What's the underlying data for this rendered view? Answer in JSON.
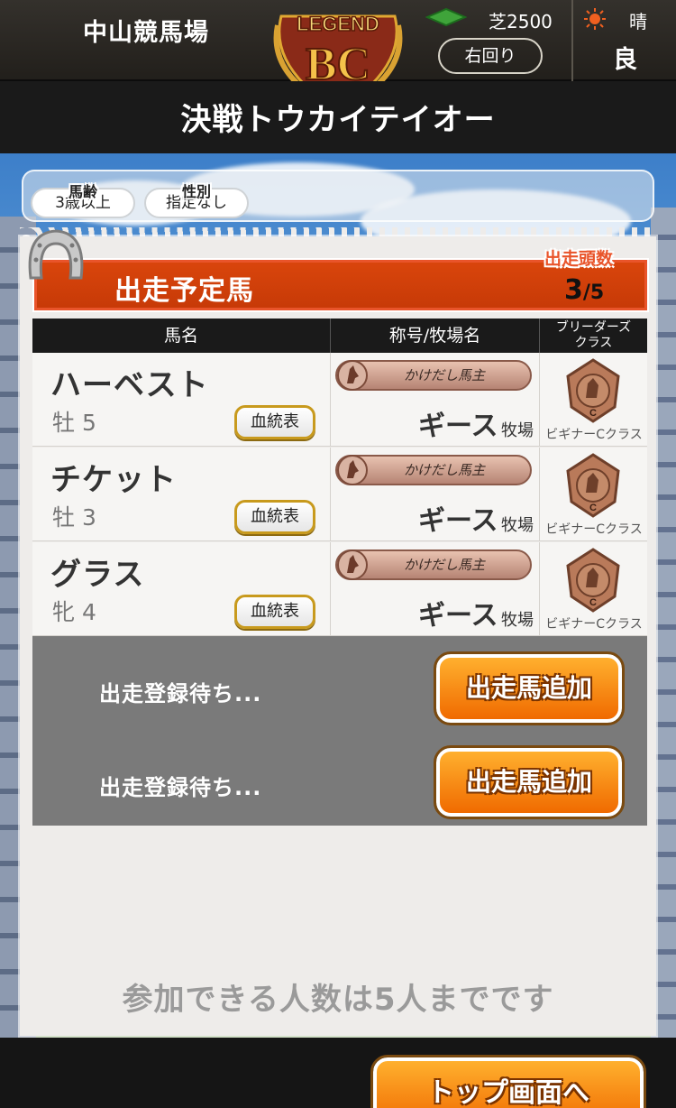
{
  "header": {
    "venue": "中山競馬場",
    "logo_text_top": "LEGEND",
    "logo_text_main": "BC",
    "surface": "芝2500",
    "direction": "右回り",
    "weather": "晴",
    "condition": "良"
  },
  "title": "決戦トウカイテイオー",
  "filters": {
    "age": {
      "label": "馬齢",
      "value": "3歳以上"
    },
    "sex": {
      "label": "性別",
      "value": "指定なし"
    }
  },
  "entries_panel": {
    "title": "出走予定馬",
    "count_label": "出走頭数",
    "count": "3",
    "count_max": "/5"
  },
  "table": {
    "headers": {
      "name": "馬名",
      "owner": "称号/牧場名",
      "class_line1": "ブリーダーズ",
      "class_line2": "クラス"
    },
    "rows": [
      {
        "name": "ハーベスト",
        "sex_age": "牡 5",
        "pedigree": "血統表",
        "title": "かけだし馬主",
        "farm": "ギース",
        "farm_suffix": "牧場",
        "class": "ビギナーCクラス"
      },
      {
        "name": "チケット",
        "sex_age": "牡 3",
        "pedigree": "血統表",
        "title": "かけだし馬主",
        "farm": "ギース",
        "farm_suffix": "牧場",
        "class": "ビギナーCクラス"
      },
      {
        "name": "グラス",
        "sex_age": "牝 4",
        "pedigree": "血統表",
        "title": "かけだし馬主",
        "farm": "ギース",
        "farm_suffix": "牧場",
        "class": "ビギナーCクラス"
      }
    ]
  },
  "pending": [
    {
      "text": "出走登録待ち...",
      "button": "出走馬追加"
    },
    {
      "text": "出走登録待ち...",
      "button": "出走馬追加"
    }
  ],
  "note": "参加できる人数は5人までです",
  "footer": {
    "top_button": "トップ画面へ"
  },
  "colors": {
    "accent": "#d9450c",
    "button": "#f58a12",
    "medal": "#b97a5a"
  }
}
